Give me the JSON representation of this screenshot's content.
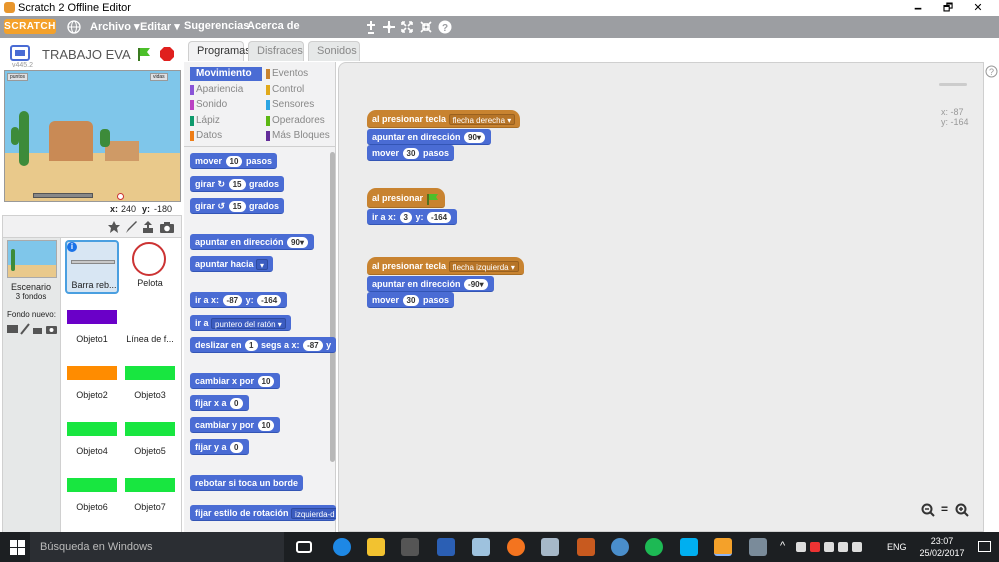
{
  "window": {
    "title": "Scratch 2 Offline Editor",
    "minimize": "🗕",
    "maximize": "🗗",
    "close": "✕"
  },
  "menubar": {
    "logo": "SCRATCH",
    "globe_icon": "globe-icon",
    "archivo": "Archivo ▾",
    "editar": "Editar ▾",
    "sugerencias": "Sugerencias",
    "acerca": "Acerca de"
  },
  "toolbar_icons": [
    "duplicate-icon",
    "delete-icon",
    "grow-icon",
    "shrink-icon",
    "help-icon"
  ],
  "stage": {
    "project_name": "TRABAJO EVA",
    "version": "v445.2",
    "monitor_left": "puntos",
    "monitor_right": "vidas",
    "mouse_x_label": "x:",
    "mouse_x": "240",
    "mouse_y_label": "y:",
    "mouse_y": "-180"
  },
  "sprites": {
    "stage_label": "Escenario",
    "stage_backdrops": "3 fondos",
    "new_backdrop_label": "Fondo nuevo:",
    "items": [
      {
        "name": "Barra reb...",
        "color": "#c8c8c8"
      },
      {
        "name": "Pelota",
        "color": "#ffffff"
      },
      {
        "name": "Objeto1",
        "color": "#6a00c8"
      },
      {
        "name": "Línea de f...",
        "color": "#ffffff"
      },
      {
        "name": "Objeto2",
        "color": "#ff8c00"
      },
      {
        "name": "Objeto3",
        "color": "#18e640"
      },
      {
        "name": "Objeto4",
        "color": "#18e640"
      },
      {
        "name": "Objeto5",
        "color": "#18e640"
      },
      {
        "name": "Objeto6",
        "color": "#18e640"
      },
      {
        "name": "Objeto7",
        "color": "#18e640"
      }
    ]
  },
  "tabs": [
    "Programas",
    "Disfraces",
    "Sonidos"
  ],
  "categories": [
    {
      "label": "Movimiento",
      "color": "#4a6cd4"
    },
    {
      "label": "Eventos",
      "color": "#c88330"
    },
    {
      "label": "Apariencia",
      "color": "#8a55d7"
    },
    {
      "label": "Control",
      "color": "#e1a91a"
    },
    {
      "label": "Sonido",
      "color": "#bb42c3"
    },
    {
      "label": "Sensores",
      "color": "#2ca5e2"
    },
    {
      "label": "Lápiz",
      "color": "#0e9a6c"
    },
    {
      "label": "Operadores",
      "color": "#5cb712"
    },
    {
      "label": "Datos",
      "color": "#ee7d16"
    },
    {
      "label": "Más Bloques",
      "color": "#632d99"
    }
  ],
  "palette": {
    "mover": "mover",
    "mover_v": "10",
    "pasos": "pasos",
    "girar": "girar",
    "girar_r_v": "15",
    "girar_l_v": "15",
    "grados": "grados",
    "apuntar_dir": "apuntar en dirección",
    "apuntar_dir_v": "90▾",
    "apuntar_hacia": "apuntar hacia",
    "apuntar_hacia_v": "▾",
    "ir_a_x": "ir a x:",
    "ir_x_v": "-87",
    "y": "y:",
    "ir_y_v": "-164",
    "ir_a": "ir a",
    "ir_a_v": "puntero del ratón ▾",
    "deslizar": "deslizar en",
    "deslizar_v": "1",
    "segs_x": "segs a x:",
    "desl_x_v": "-87",
    "desl_y": "y",
    "cambiar_x": "cambiar x por",
    "cambiar_x_v": "10",
    "fijar_x": "fijar x a",
    "fijar_x_v": "0",
    "cambiar_y": "cambiar y por",
    "cambiar_y_v": "10",
    "fijar_y": "fijar y a",
    "fijar_y_v": "0",
    "rebotar": "rebotar si toca un borde",
    "fijar_estilo": "fijar estilo de rotación",
    "fijar_estilo_v": "izquierda-d"
  },
  "scripts": {
    "coord_x": "x: -87",
    "coord_y": "y: -164",
    "s1_hat": "al presionar tecla",
    "s1_key": "flecha derecha ▾",
    "s1_b1": "apuntar en dirección",
    "s1_b1_v": "90▾",
    "s1_b2": "mover",
    "s1_b2_v": "30",
    "s1_b2_s": "pasos",
    "s2_hat": "al presionar",
    "s2_b1": "ir a x:",
    "s2_b1_x": "3",
    "s2_b1_y_label": "y:",
    "s2_b1_y": "-164",
    "s3_hat": "al presionar tecla",
    "s3_key": "flecha izquierda ▾",
    "s3_b1": "apuntar en dirección",
    "s3_b1_v": "-90▾",
    "s3_b2": "mover",
    "s3_b2_v": "30",
    "s3_b2_s": "pasos",
    "zoom_out": "−",
    "zoom_reset": "=",
    "zoom_in": "+"
  },
  "taskbar": {
    "search_placeholder": "Búsqueda en Windows",
    "lang": "ENG",
    "time": "23:07",
    "date": "25/02/2017"
  }
}
